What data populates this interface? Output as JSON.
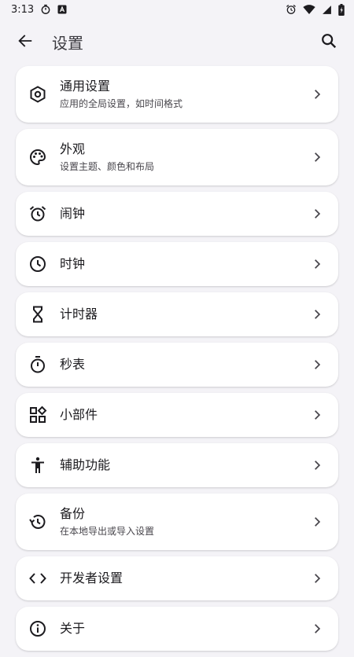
{
  "status": {
    "time": "3:13"
  },
  "app_bar": {
    "title": "设置"
  },
  "items": [
    {
      "title": "通用设置",
      "subtitle": "应用的全局设置，如时间格式",
      "icon": "settings-hexagon-icon"
    },
    {
      "title": "外观",
      "subtitle": "设置主题、颜色和布局",
      "icon": "palette-icon"
    },
    {
      "title": "闹钟",
      "icon": "alarm-icon"
    },
    {
      "title": "时钟",
      "icon": "clock-icon"
    },
    {
      "title": "计时器",
      "icon": "hourglass-icon"
    },
    {
      "title": "秒表",
      "icon": "stopwatch-icon"
    },
    {
      "title": "小部件",
      "icon": "widgets-icon"
    },
    {
      "title": "辅助功能",
      "icon": "accessibility-icon"
    },
    {
      "title": "备份",
      "subtitle": "在本地导出或导入设置",
      "icon": "restore-icon"
    },
    {
      "title": "开发者设置",
      "icon": "code-icon"
    },
    {
      "title": "关于",
      "icon": "info-icon"
    }
  ]
}
